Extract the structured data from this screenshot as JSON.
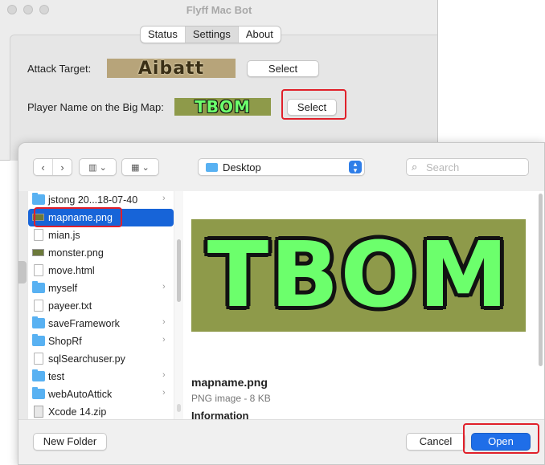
{
  "app": {
    "title": "Flyff Mac Bot",
    "tabs": [
      {
        "label": "Status",
        "active": false
      },
      {
        "label": "Settings",
        "active": true
      },
      {
        "label": "About",
        "active": false
      }
    ],
    "attack_target": {
      "label": "Attack Target:",
      "captured_image_text": "Aibatt",
      "button_label": "Select"
    },
    "player_name": {
      "label": "Player Name on the Big Map:",
      "captured_image_text": "TBOM",
      "button_label": "Select"
    }
  },
  "dialog": {
    "location": "Desktop",
    "search_placeholder": "Search",
    "files": [
      {
        "name": "jstong 20...18-07-40",
        "icon": "folder-icon",
        "has_children": true,
        "selected": false
      },
      {
        "name": "mapname.png",
        "icon": "image-file-icon",
        "has_children": false,
        "selected": true
      },
      {
        "name": "mian.js",
        "icon": "document-icon",
        "has_children": false,
        "selected": false
      },
      {
        "name": "monster.png",
        "icon": "image-file-icon",
        "has_children": false,
        "selected": false
      },
      {
        "name": "move.html",
        "icon": "document-icon",
        "has_children": false,
        "selected": false
      },
      {
        "name": "myself",
        "icon": "folder-icon",
        "has_children": true,
        "selected": false
      },
      {
        "name": "payeer.txt",
        "icon": "document-icon",
        "has_children": false,
        "selected": false
      },
      {
        "name": "saveFramework",
        "icon": "folder-icon",
        "has_children": true,
        "selected": false
      },
      {
        "name": "ShopRf",
        "icon": "folder-icon",
        "has_children": true,
        "selected": false
      },
      {
        "name": "sqlSearchuser.py",
        "icon": "document-icon",
        "has_children": false,
        "selected": false
      },
      {
        "name": "test",
        "icon": "folder-icon",
        "has_children": true,
        "selected": false
      },
      {
        "name": "webAutoAttick",
        "icon": "folder-icon",
        "has_children": true,
        "selected": false
      },
      {
        "name": "Xcode 14.zip",
        "icon": "zip-file-icon",
        "has_children": false,
        "selected": false
      }
    ],
    "preview": {
      "image_text": "TBOM",
      "file_name": "mapname.png",
      "file_kind": "PNG image - 8 KB",
      "info_heading": "Information"
    },
    "buttons": {
      "new_folder": "New Folder",
      "cancel": "Cancel",
      "open": "Open"
    }
  },
  "colors": {
    "accent": "#1f6ee8",
    "selection": "#1764d8",
    "highlight_box": "#e0202a",
    "capture_green": "#6cff6c"
  }
}
